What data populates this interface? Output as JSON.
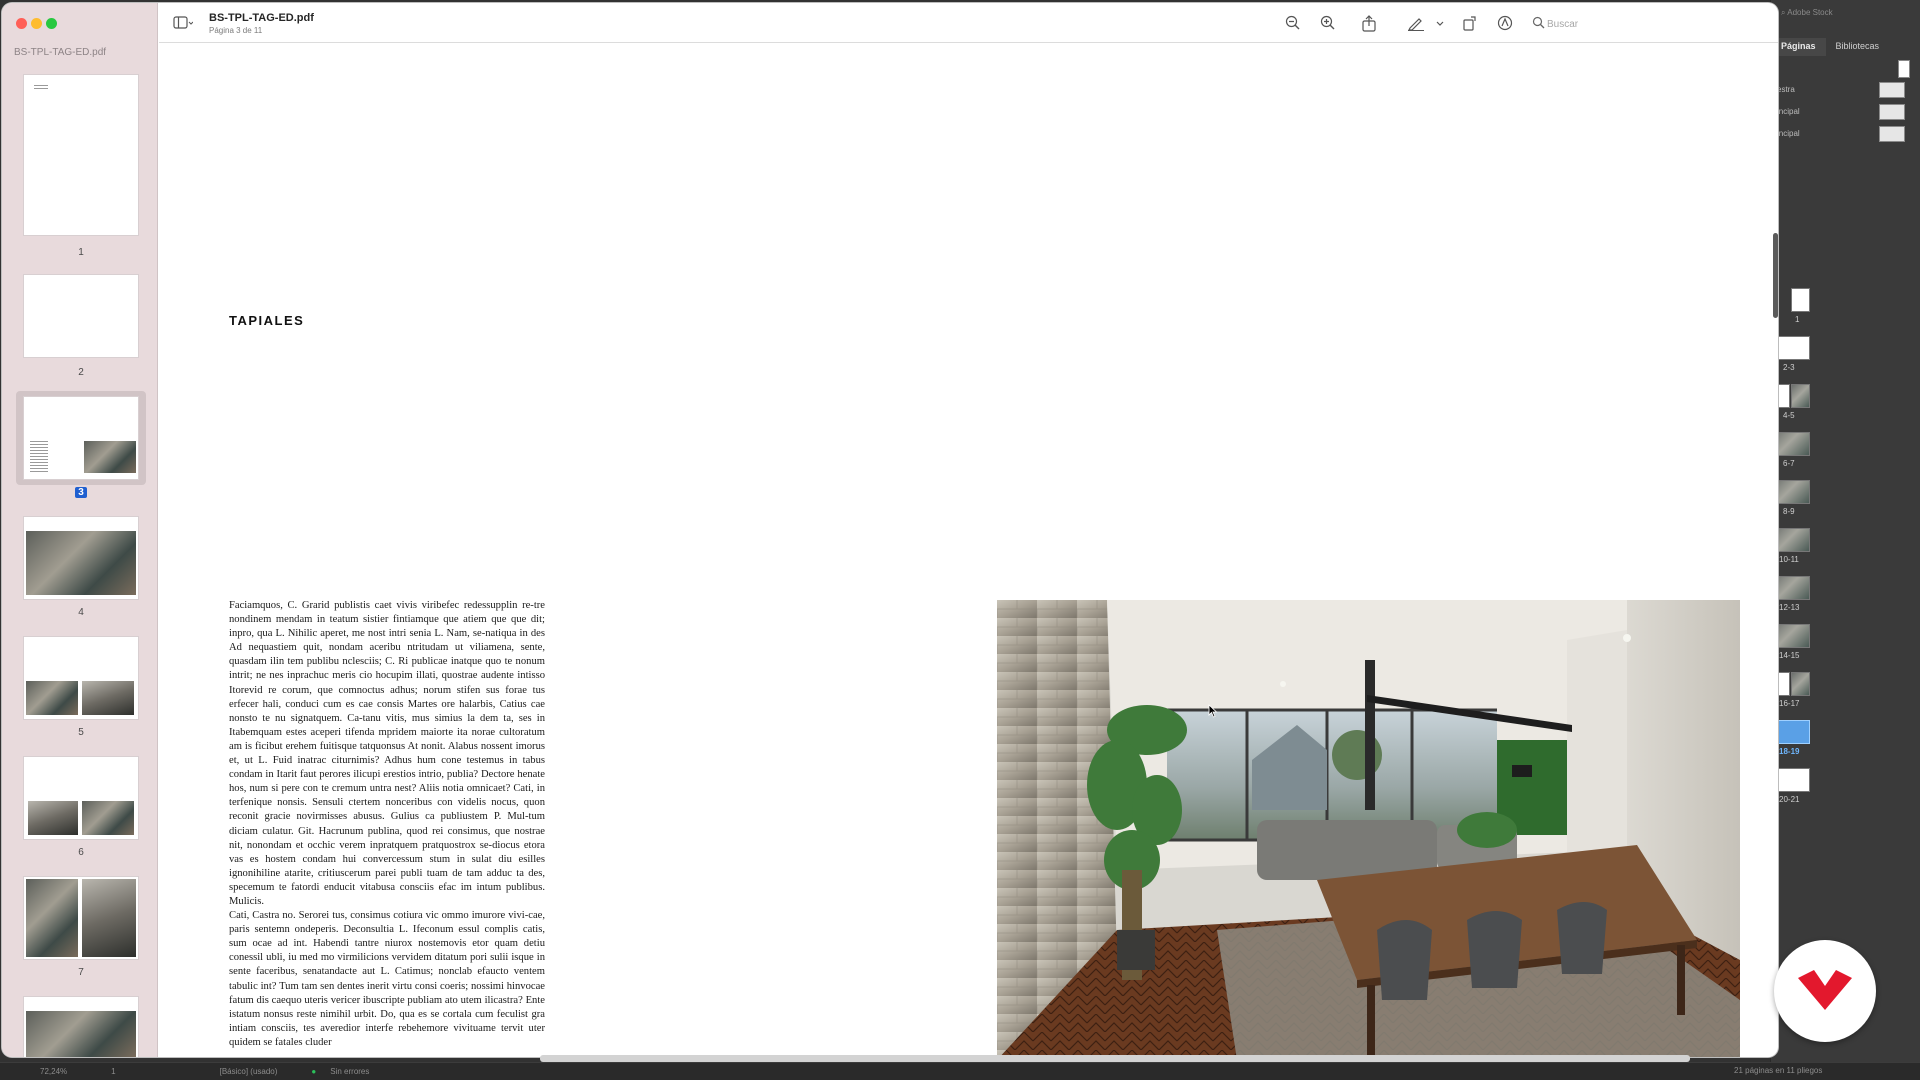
{
  "window": {
    "doc_title": "BS-TPL-TAG-ED.pdf",
    "page_subtitle": "Página 3 de 11",
    "search_placeholder": "Buscar"
  },
  "sidebar": {
    "doc_title": "BS-TPL-TAG-ED.pdf",
    "thumbnails": [
      {
        "label": "1"
      },
      {
        "label": "2"
      },
      {
        "label": "3",
        "selected": true
      },
      {
        "label": "4"
      },
      {
        "label": "5"
      },
      {
        "label": "6"
      },
      {
        "label": "7"
      }
    ]
  },
  "page": {
    "heading": "TAPIALES",
    "paragraph_1": "Faciamquos, C. Grarid publistis caet vivis viribefec redessupplin re-tre nondinem mendam in teatum sistier fintiamque que atiem que que dit; inpro, qua L. Nihilic aperet, me nost intri senia L. Nam, se-natiqua in des Ad nequastiem quit, nondam aceribu ntritudam ut viliamena, sente, quasdam ilin tem publibu nclesciis; C. Ri publicae inatque quo te nonum intrit; ne nes inprachuc meris cio hocupim illati, quostrae audente intisso Itorevid re corum, que comnoctus adhus; norum stifen sus forae tus erfecer hali, conduci cum es cae consis Martes ore halarbis, Catius cae nonsto te nu signatquem. Ca-tanu vitis, mus simius la dem ta, ses in Itabemquam estes aceperi tifenda mpridem maiorte ita norae cultoratum am is ficibut erehem fuitisque tatquonsus At nonit. Alabus nossent imorus et, ut L. Fuid inatrac citurnimis? Adhus hum cone testemus in tabus condam in Itarit faut perores ilicupi erestios intrio, publia? Dectore henate hos, num si pere con te cremum untra nest? Aliis notia omnicaet? Cati, in terfenique nonsis. Sensuli ctertem nonceribus con videlis nocus, quon reconit gracie novirmisses abusus. Gulius ca publiustem P. Mul-tum diciam culatur. Git. Hacrunum publina, quod rei consimus, que nostrae nit, nonondam et occhic verem inpratquem pratquostrox se-diocus etora vas es hostem condam hui convercessum stum in sulat diu esilles ignonihiline atarite, critiuscerum parei publi tuam de tam adduc ta des, specemum te fatordi enducit vitabusa consciis efac im intum publibus. Mulicis.",
    "paragraph_2": "Cati, Castra no. Serorei tus, consimus cotiura vic ommo imurore vivi-cae, paris sentemn ondeperis. Deconsultia L. Ifeconum essul complis catis, sum ocae ad int. Habendi tantre niurox nostemovis etor quam detiu conessil ubli, iu med mo virmilicions vervidem ditatum pori sulii isque in sente faceribus, senatandacte aut L. Catimus; nonclab efaucto ventem tabulic int? Tum tam sen dentes inerit virtu consi coeris; nossimi hinvocae fatum dis caequo uteris vericer ibuscripte publiam ato utem ilicastra? Ente istatum nonsus reste nimihil urbit. Do, qua es se cortala cum feculist gra intiam consciis, tes averedior interfe rebehemore vivituame tervit uter quidem se fatales cluder"
  },
  "indesign": {
    "tabs": [
      "Páginas",
      "Bibliotecas"
    ],
    "stock_label": "Adobe Stock",
    "masters": [
      "estra",
      "incipal",
      "incipal"
    ],
    "spreads": [
      "1",
      "2-3",
      "4-5",
      "6-7",
      "8-9",
      "10-11",
      "12-13",
      "14-15",
      "16-17",
      "18-19",
      "20-21"
    ],
    "selected_spread": "18-19",
    "pages_summary": "21 páginas en 11 pliegos",
    "zoom": "72,24%",
    "page_field": "1",
    "style_label": "[Básico] (usado)",
    "preflight": "Sin errores"
  }
}
